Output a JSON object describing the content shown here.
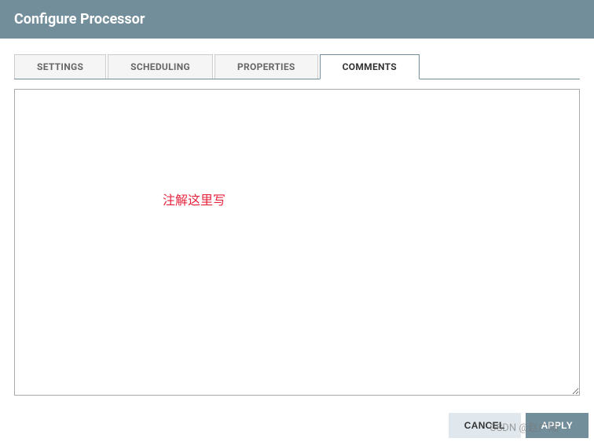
{
  "header": {
    "title": "Configure Processor"
  },
  "tabs": {
    "settings": "SETTINGS",
    "scheduling": "SCHEDULING",
    "properties": "PROPERTIES",
    "comments": "COMMENTS"
  },
  "comments_value": "",
  "annotation": "注解这里写",
  "footer": {
    "cancel": "CANCEL",
    "apply": "APPLY"
  },
  "watermark": "CSDN @赵广陆"
}
